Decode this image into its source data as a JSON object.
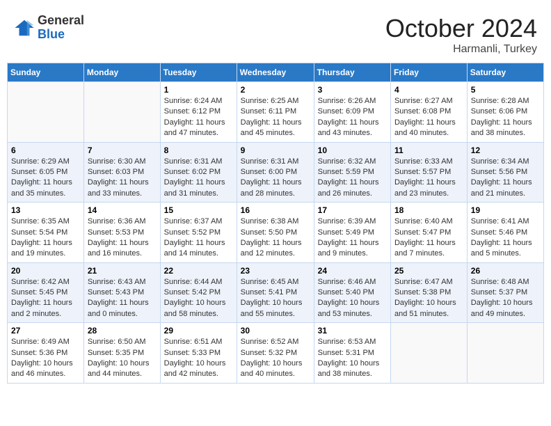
{
  "header": {
    "logo_general": "General",
    "logo_blue": "Blue",
    "month_title": "October 2024",
    "subtitle": "Harmanli, Turkey"
  },
  "days_of_week": [
    "Sunday",
    "Monday",
    "Tuesday",
    "Wednesday",
    "Thursday",
    "Friday",
    "Saturday"
  ],
  "weeks": [
    [
      {
        "day": "",
        "info": ""
      },
      {
        "day": "",
        "info": ""
      },
      {
        "day": "1",
        "info": "Sunrise: 6:24 AM\nSunset: 6:12 PM\nDaylight: 11 hours and 47 minutes."
      },
      {
        "day": "2",
        "info": "Sunrise: 6:25 AM\nSunset: 6:11 PM\nDaylight: 11 hours and 45 minutes."
      },
      {
        "day": "3",
        "info": "Sunrise: 6:26 AM\nSunset: 6:09 PM\nDaylight: 11 hours and 43 minutes."
      },
      {
        "day": "4",
        "info": "Sunrise: 6:27 AM\nSunset: 6:08 PM\nDaylight: 11 hours and 40 minutes."
      },
      {
        "day": "5",
        "info": "Sunrise: 6:28 AM\nSunset: 6:06 PM\nDaylight: 11 hours and 38 minutes."
      }
    ],
    [
      {
        "day": "6",
        "info": "Sunrise: 6:29 AM\nSunset: 6:05 PM\nDaylight: 11 hours and 35 minutes."
      },
      {
        "day": "7",
        "info": "Sunrise: 6:30 AM\nSunset: 6:03 PM\nDaylight: 11 hours and 33 minutes."
      },
      {
        "day": "8",
        "info": "Sunrise: 6:31 AM\nSunset: 6:02 PM\nDaylight: 11 hours and 31 minutes."
      },
      {
        "day": "9",
        "info": "Sunrise: 6:31 AM\nSunset: 6:00 PM\nDaylight: 11 hours and 28 minutes."
      },
      {
        "day": "10",
        "info": "Sunrise: 6:32 AM\nSunset: 5:59 PM\nDaylight: 11 hours and 26 minutes."
      },
      {
        "day": "11",
        "info": "Sunrise: 6:33 AM\nSunset: 5:57 PM\nDaylight: 11 hours and 23 minutes."
      },
      {
        "day": "12",
        "info": "Sunrise: 6:34 AM\nSunset: 5:56 PM\nDaylight: 11 hours and 21 minutes."
      }
    ],
    [
      {
        "day": "13",
        "info": "Sunrise: 6:35 AM\nSunset: 5:54 PM\nDaylight: 11 hours and 19 minutes."
      },
      {
        "day": "14",
        "info": "Sunrise: 6:36 AM\nSunset: 5:53 PM\nDaylight: 11 hours and 16 minutes."
      },
      {
        "day": "15",
        "info": "Sunrise: 6:37 AM\nSunset: 5:52 PM\nDaylight: 11 hours and 14 minutes."
      },
      {
        "day": "16",
        "info": "Sunrise: 6:38 AM\nSunset: 5:50 PM\nDaylight: 11 hours and 12 minutes."
      },
      {
        "day": "17",
        "info": "Sunrise: 6:39 AM\nSunset: 5:49 PM\nDaylight: 11 hours and 9 minutes."
      },
      {
        "day": "18",
        "info": "Sunrise: 6:40 AM\nSunset: 5:47 PM\nDaylight: 11 hours and 7 minutes."
      },
      {
        "day": "19",
        "info": "Sunrise: 6:41 AM\nSunset: 5:46 PM\nDaylight: 11 hours and 5 minutes."
      }
    ],
    [
      {
        "day": "20",
        "info": "Sunrise: 6:42 AM\nSunset: 5:45 PM\nDaylight: 11 hours and 2 minutes."
      },
      {
        "day": "21",
        "info": "Sunrise: 6:43 AM\nSunset: 5:43 PM\nDaylight: 11 hours and 0 minutes."
      },
      {
        "day": "22",
        "info": "Sunrise: 6:44 AM\nSunset: 5:42 PM\nDaylight: 10 hours and 58 minutes."
      },
      {
        "day": "23",
        "info": "Sunrise: 6:45 AM\nSunset: 5:41 PM\nDaylight: 10 hours and 55 minutes."
      },
      {
        "day": "24",
        "info": "Sunrise: 6:46 AM\nSunset: 5:40 PM\nDaylight: 10 hours and 53 minutes."
      },
      {
        "day": "25",
        "info": "Sunrise: 6:47 AM\nSunset: 5:38 PM\nDaylight: 10 hours and 51 minutes."
      },
      {
        "day": "26",
        "info": "Sunrise: 6:48 AM\nSunset: 5:37 PM\nDaylight: 10 hours and 49 minutes."
      }
    ],
    [
      {
        "day": "27",
        "info": "Sunrise: 6:49 AM\nSunset: 5:36 PM\nDaylight: 10 hours and 46 minutes."
      },
      {
        "day": "28",
        "info": "Sunrise: 6:50 AM\nSunset: 5:35 PM\nDaylight: 10 hours and 44 minutes."
      },
      {
        "day": "29",
        "info": "Sunrise: 6:51 AM\nSunset: 5:33 PM\nDaylight: 10 hours and 42 minutes."
      },
      {
        "day": "30",
        "info": "Sunrise: 6:52 AM\nSunset: 5:32 PM\nDaylight: 10 hours and 40 minutes."
      },
      {
        "day": "31",
        "info": "Sunrise: 6:53 AM\nSunset: 5:31 PM\nDaylight: 10 hours and 38 minutes."
      },
      {
        "day": "",
        "info": ""
      },
      {
        "day": "",
        "info": ""
      }
    ]
  ]
}
